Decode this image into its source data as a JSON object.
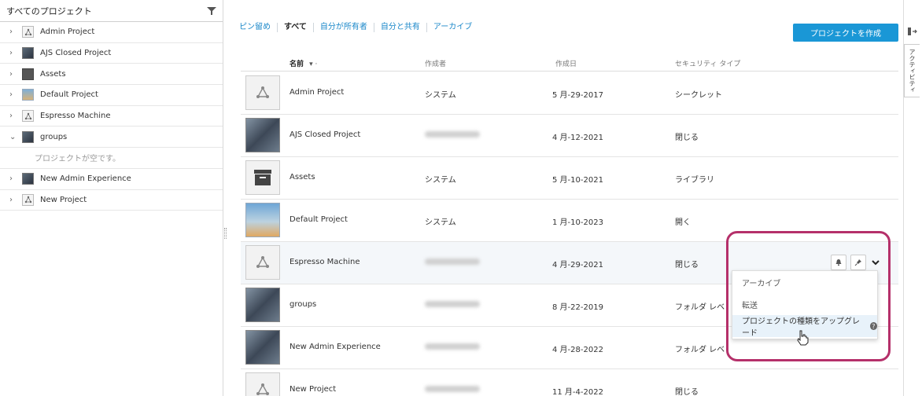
{
  "sidebar": {
    "title": "すべてのプロジェクト",
    "items": [
      {
        "label": "Admin Project",
        "thumb": "triangle",
        "chev": "›"
      },
      {
        "label": "AJS Closed Project",
        "thumb": "photo",
        "chev": "›"
      },
      {
        "label": "Assets",
        "thumb": "box",
        "chev": "›"
      },
      {
        "label": "Default Project",
        "thumb": "sky",
        "chev": "›"
      },
      {
        "label": "Espresso Machine",
        "thumb": "triangle",
        "chev": "›"
      },
      {
        "label": "groups",
        "thumb": "photo",
        "chev": "⌄"
      },
      {
        "label": "New Admin Experience",
        "thumb": "photo",
        "chev": "›"
      },
      {
        "label": "New Project",
        "thumb": "triangle",
        "chev": "›"
      }
    ],
    "empty_text": "プロジェクトが空です。"
  },
  "filters": [
    "ピン留め",
    "すべて",
    "自分が所有者",
    "自分と共有",
    "アーカイブ"
  ],
  "create_button": "プロジェクトを作成",
  "columns": {
    "name": "名前",
    "sort": "▾ ·",
    "owner": "作成者",
    "date": "作成日",
    "security": "セキュリティ タイプ"
  },
  "rows": [
    {
      "name": "Admin Project",
      "owner": "システム",
      "date": "5 月-29-2017",
      "security": "シークレット",
      "thumb": "triangle"
    },
    {
      "name": "AJS Closed Project",
      "owner": "",
      "date": "4 月-12-2021",
      "security": "閉じる",
      "thumb": "photo"
    },
    {
      "name": "Assets",
      "owner": "システム",
      "date": "5 月-10-2021",
      "security": "ライブラリ",
      "thumb": "archive"
    },
    {
      "name": "Default Project",
      "owner": "システム",
      "date": "1 月-10-2023",
      "security": "開く",
      "thumb": "sky"
    },
    {
      "name": "Espresso Machine",
      "owner": "",
      "date": "4 月-29-2021",
      "security": "閉じる",
      "thumb": "triangle"
    },
    {
      "name": "groups",
      "owner": "",
      "date": "8 月-22-2019",
      "security": "フォルダ レベ",
      "thumb": "photo"
    },
    {
      "name": "New Admin Experience",
      "owner": "",
      "date": "4 月-28-2022",
      "security": "フォルダ レベ",
      "thumb": "photo"
    },
    {
      "name": "New Project",
      "owner": "",
      "date": "11 月-4-2022",
      "security": "閉じる",
      "thumb": "triangle"
    }
  ],
  "dropdown": {
    "items": [
      "アーカイブ",
      "転送",
      "プロジェクトの種類をアップグレード"
    ],
    "help": "?"
  },
  "activity_tab": "アクティビティ",
  "colors": {
    "accent": "#1a97d6",
    "link": "#1a87c9",
    "ring": "#b5306a"
  }
}
